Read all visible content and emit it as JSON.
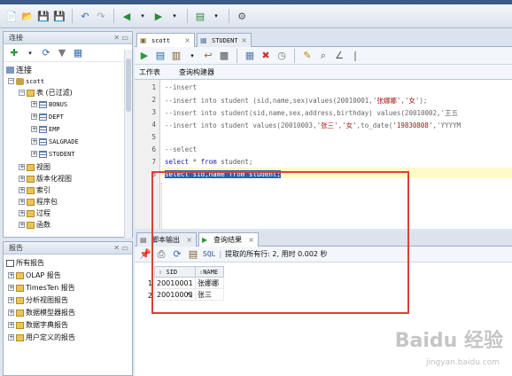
{
  "connections_panel": {
    "title": "连接",
    "tree": {
      "root": "连接",
      "connection": "scott",
      "tables_node": "表 (已过滤)",
      "tables": [
        "BONUS",
        "DEPT",
        "EMP",
        "SALGRADE",
        "STUDENT"
      ],
      "other_nodes": [
        "视图",
        "版本化视图",
        "索引",
        "程序包",
        "过程",
        "函数"
      ]
    }
  },
  "reports_panel": {
    "title": "报告",
    "items": [
      "所有报告",
      "OLAP 报告",
      "TimesTen 报告",
      "分析视图报告",
      "数据模型器报告",
      "数据字典报告",
      "用户定义的报告"
    ]
  },
  "editor_tabs": [
    {
      "label": "scott",
      "icon": "sql-worksheet-icon"
    },
    {
      "label": "STUDENT",
      "icon": "table-icon"
    }
  ],
  "editor_subtabs": [
    "工作表",
    "查询构建器"
  ],
  "editor_lines": [
    {
      "n": "1",
      "text": "--insert"
    },
    {
      "n": "2",
      "text": "--insert into student (sid,name,sex)values(20010001,'张娜娜','女');"
    },
    {
      "n": "3",
      "text": "--insert into student(sid,name,sex,address,birthday) values(20010002,'王五"
    },
    {
      "n": "4",
      "text": "--insert into student values(20010003,'张三','女',to_date('19830808','YYYYM"
    },
    {
      "n": "5",
      "text": ""
    },
    {
      "n": "6",
      "text": "--select"
    },
    {
      "n": "7",
      "text": "select * from student;"
    },
    {
      "n": "8",
      "text": "select sid,name from student;"
    }
  ],
  "output_tabs": [
    "脚本输出",
    "查询结果"
  ],
  "output_status": "提取的所有行: 2, 用时 0.002 秒",
  "sql_label": "SQL",
  "result_columns": [
    "SID",
    "NAME"
  ],
  "result_rows": [
    {
      "row": "1",
      "SID": "20010001",
      "NAME": "张娜娜"
    },
    {
      "row": "2",
      "SID": "20010003",
      "NAME": "张三"
    }
  ],
  "watermark": {
    "main": "Baidu 经验",
    "sub": "jingyan.baidu.com"
  },
  "colors": {
    "highlight_box": "#e23c3c",
    "selection": "#2f5fb0",
    "keyword": "#1a1ab4"
  }
}
